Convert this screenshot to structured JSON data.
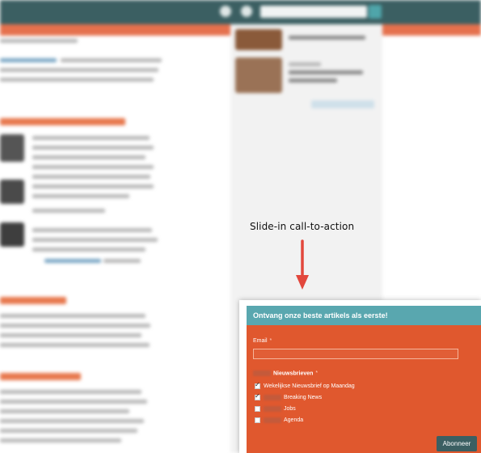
{
  "annotation": {
    "label": "Slide-in call-to-action"
  },
  "slidein": {
    "title": "Ontvang onze beste artikels als eerste!",
    "email_label": "Email",
    "required_mark": "*",
    "email_value": "",
    "newsletters_label": "Nieuwsbrieven",
    "options": [
      {
        "label": "Wekelijkse Nieuwsbrief op Maandag",
        "checked": true
      },
      {
        "label": "Breaking News",
        "checked": true
      },
      {
        "label": "Jobs",
        "checked": false
      },
      {
        "label": "Agenda",
        "checked": false
      }
    ],
    "submit_label": "Abonneer"
  },
  "colors": {
    "header_teal": "#59a7af",
    "panel_orange": "#e0582e",
    "button_dark": "#3b5f62"
  }
}
